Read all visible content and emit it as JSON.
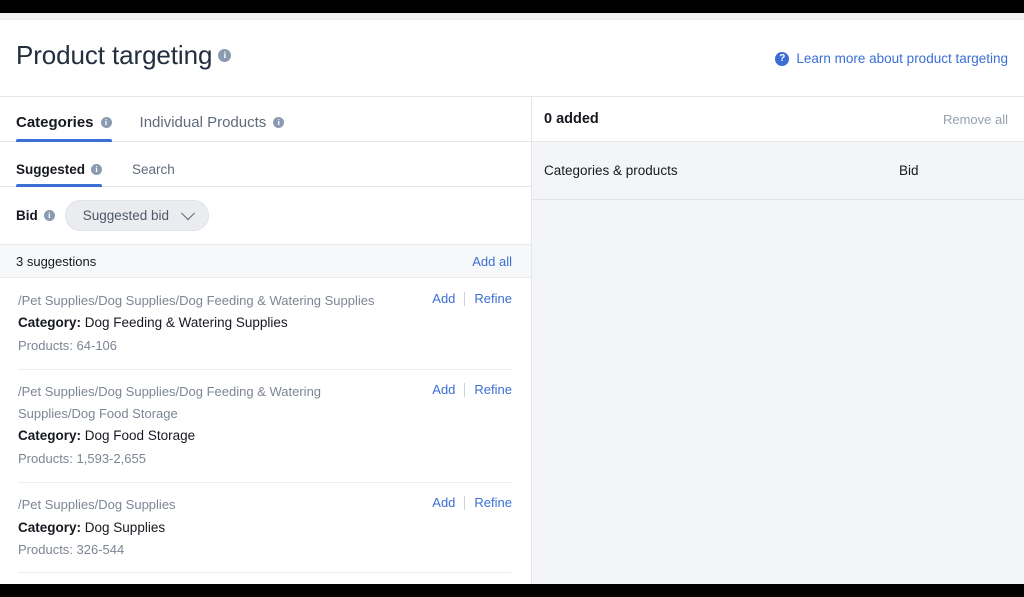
{
  "header": {
    "title": "Product targeting",
    "title_info_icon": "info-icon",
    "learn_more": {
      "icon": "help-circle-icon",
      "label": "Learn more about product targeting"
    }
  },
  "tabs": [
    {
      "label": "Categories",
      "info_icon": "info-icon",
      "active": true
    },
    {
      "label": "Individual Products",
      "info_icon": "info-icon",
      "active": false
    }
  ],
  "subtabs": [
    {
      "label": "Suggested",
      "info_icon": "info-icon",
      "active": true
    },
    {
      "label": "Search",
      "active": false
    }
  ],
  "bid": {
    "label": "Bid",
    "info_icon": "info-icon",
    "selected": "Suggested bid",
    "chevron_icon": "chevron-down-icon"
  },
  "suggestions_bar": {
    "count_label": "3 suggestions",
    "add_all_label": "Add all"
  },
  "suggestions": [
    {
      "path": "/Pet Supplies/Dog Supplies/Dog Feeding & Watering Supplies",
      "category_key": "Category:",
      "category_value": "Dog Feeding & Watering Supplies",
      "products": "Products: 64-106",
      "add_label": "Add",
      "refine_label": "Refine"
    },
    {
      "path": "/Pet Supplies/Dog Supplies/Dog Feeding & Watering Supplies/Dog Food Storage",
      "category_key": "Category:",
      "category_value": "Dog Food Storage",
      "products": "Products: 1,593-2,655",
      "add_label": "Add",
      "refine_label": "Refine"
    },
    {
      "path": "/Pet Supplies/Dog Supplies",
      "category_key": "Category:",
      "category_value": "Dog Supplies",
      "products": "Products: 326-544",
      "add_label": "Add",
      "refine_label": "Refine"
    }
  ],
  "added_panel": {
    "count_label": "0 added",
    "remove_all_label": "Remove all",
    "columns": {
      "categories_products": "Categories & products",
      "bid": "Bid"
    }
  },
  "colors": {
    "accent": "#3b6fd4",
    "link": "#3b6fd4",
    "text": "#16191f",
    "muted": "#7d8694",
    "panel_bg": "#f4f5f6",
    "border": "#e4e6e7"
  }
}
